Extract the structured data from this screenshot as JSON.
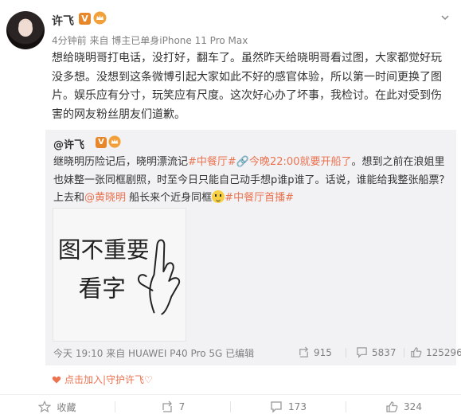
{
  "post": {
    "author": "许飞",
    "verified_badge": "V",
    "meta": "4分钟前 来自 博主已单身iPhone 11 Pro Max",
    "text": "想给晓明哥打电话，没打好，翻车了。虽然昨天给晓明哥看过图，大家都觉好玩没多想。没想到这条微博引起大家如此不好的感官体验，所以第一时间更换了图片。娱乐应有分寸，玩笑应有尺度。这次好心办了坏事，我检讨。在此对受到伤害的网友粉丝朋友们道歉。"
  },
  "repost": {
    "author": "@许飞",
    "verified_badge": "V",
    "text_part1": "继晓明历险记后，晓明漂流记",
    "tag1": "#中餐厅#",
    "link1": "今晚22:00就要开船了",
    "text_part2": "。想到之前在浪姐里也妹整一张同框剧照，时至今日只能自己动手想p谁p谁了。话说，谁能给我整张船票？上去和",
    "mention": "@黄晓明",
    "text_part3": " 船长来个近身同框",
    "tag2": "#中餐厅首播#",
    "image_text_line1": "图不重要",
    "image_text_line2": "看字",
    "meta": "今天 19:10 来自 HUAWEI P40 Pro 5G  已编辑",
    "reposts": "915",
    "comments": "5837",
    "likes": "125296"
  },
  "guard_link": "点击加入|守护许飞♡",
  "actions": {
    "favorite": "收藏",
    "repost": "7",
    "comment": "173",
    "like": "324"
  },
  "colors": {
    "accent": "#eb7350",
    "vip": "#e8872a",
    "repost_bg": "#f2f2f5"
  },
  "icons": [
    "chevron-down-icon",
    "crown-icon",
    "emoji-icon",
    "repost-icon",
    "comment-icon",
    "like-icon",
    "favorite-icon",
    "heart-icon",
    "link-icon"
  ]
}
